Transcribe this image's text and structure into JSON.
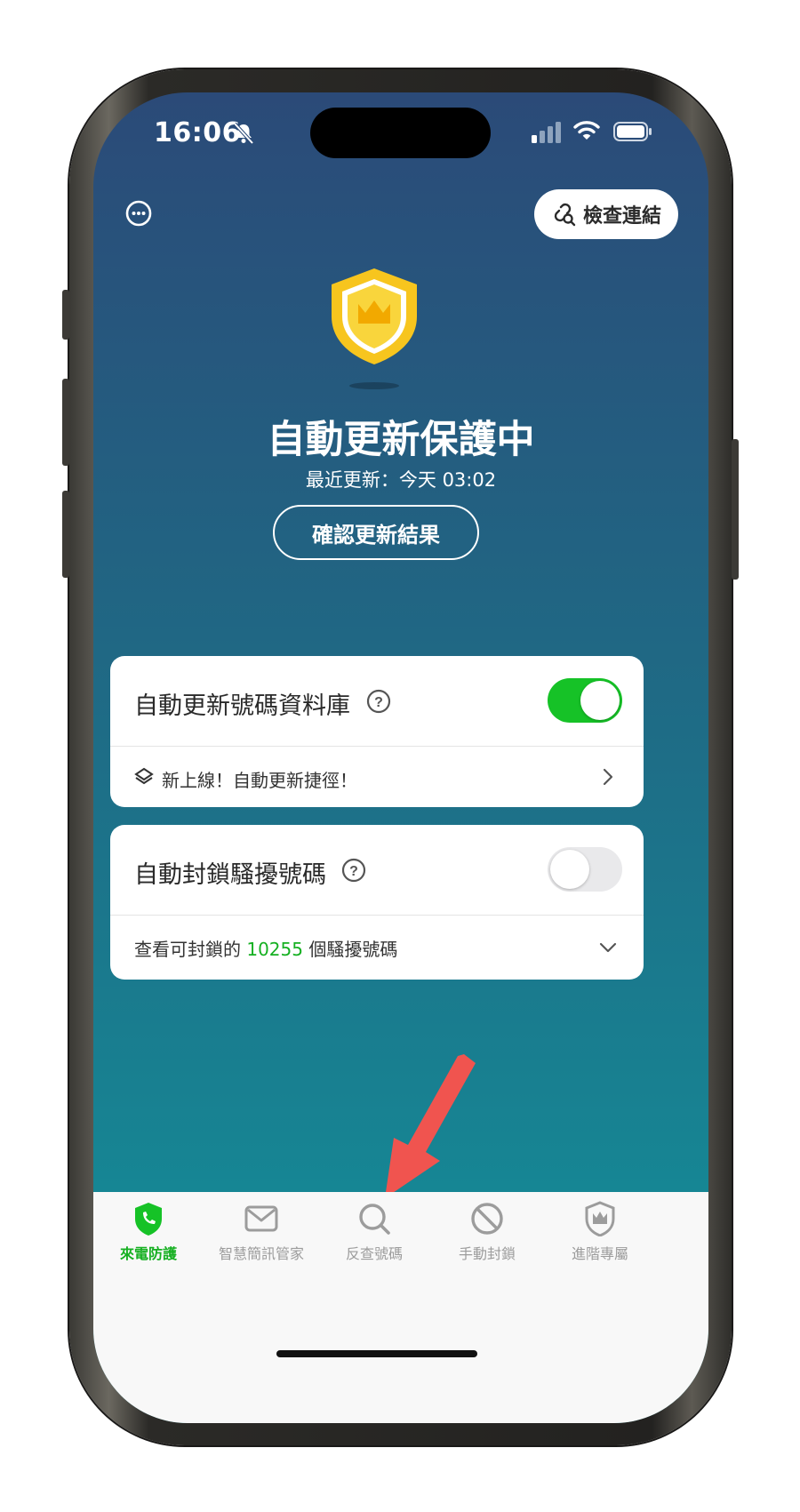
{
  "status_bar": {
    "time": "16:06"
  },
  "header": {
    "check_link_label": "檢查連結"
  },
  "protection": {
    "title": "自動更新保護中",
    "last_update": "最近更新：今天 03:02",
    "confirm_button": "確認更新結果"
  },
  "cards": {
    "auto_update": {
      "title": "自動更新號碼資料庫",
      "toggle_on": true,
      "promo": "新上線！自動更新捷徑！"
    },
    "auto_block": {
      "title": "自動封鎖騷擾號碼",
      "toggle_on": false,
      "count_prefix": "查看可封鎖的",
      "count": "10255",
      "count_suffix": "個騷擾號碼"
    }
  },
  "tabs": [
    {
      "label": "來電防護",
      "icon": "phone-shield-icon",
      "active": true
    },
    {
      "label": "智慧簡訊管家",
      "icon": "envelope-icon",
      "active": false
    },
    {
      "label": "反查號碼",
      "icon": "search-icon",
      "active": false
    },
    {
      "label": "手動封鎖",
      "icon": "block-icon",
      "active": false
    },
    {
      "label": "進階專屬",
      "icon": "crown-shield-icon",
      "active": false
    }
  ],
  "colors": {
    "accent_green": "#16c227",
    "gradient_top": "#2b4a78",
    "gradient_bottom": "#12939b",
    "arrow_red": "#f0544f",
    "shield_yellow": "#f7c51e"
  }
}
